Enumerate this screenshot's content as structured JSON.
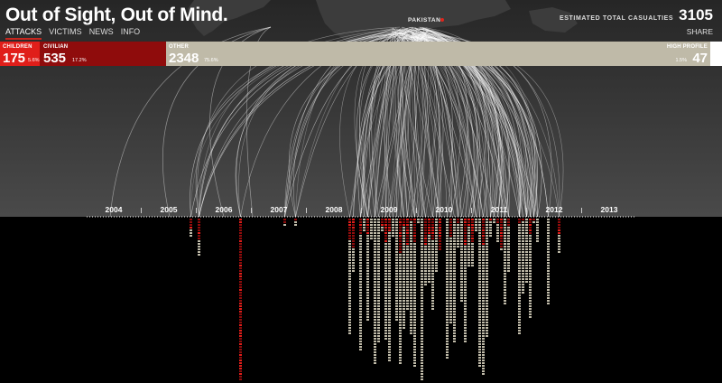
{
  "header": {
    "title": "Out of Sight, Out of Mind.",
    "nav": [
      "ATTACKS",
      "VICTIMS",
      "NEWS",
      "INFO"
    ],
    "active_nav": "ATTACKS",
    "map_label": "PAKISTAN",
    "estimated_label": "ESTIMATED TOTAL CASUALTIES",
    "estimated_value": "3105",
    "share": "SHARE"
  },
  "breakdown": {
    "children": {
      "label": "CHILDREN",
      "value": "175",
      "percent": "5.6%"
    },
    "civilian": {
      "label": "CIVILIAN",
      "value": "535",
      "percent": "17.2%"
    },
    "other": {
      "label": "OTHER",
      "value": "2348",
      "percent": "75.6%"
    },
    "high_profile": {
      "label": "HIGH PROFILE",
      "value": "47",
      "percent": "1.5%"
    }
  },
  "timeline": {
    "years": [
      "2004",
      "2005",
      "2006",
      "2007",
      "2008",
      "2009",
      "2010",
      "2011",
      "2012",
      "2013"
    ]
  },
  "colors": {
    "children": "#e01e1a",
    "civilian": "#8f0c0c",
    "other": "#bfbaa8",
    "high_profile": "#ffffff",
    "accent": "#c8261e"
  }
}
